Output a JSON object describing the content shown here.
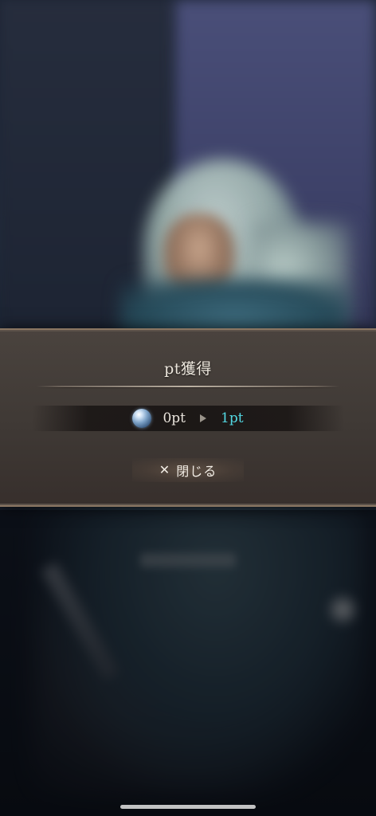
{
  "dialog": {
    "title": "pt獲得",
    "points": {
      "icon": "globe-orb-icon",
      "old_value": "0pt",
      "arrow_icon": "arrow-right-icon",
      "new_value": "1pt",
      "new_value_color": "#53d8e3"
    },
    "close_button": {
      "icon": "close-x-icon",
      "label": "閉じる"
    }
  }
}
